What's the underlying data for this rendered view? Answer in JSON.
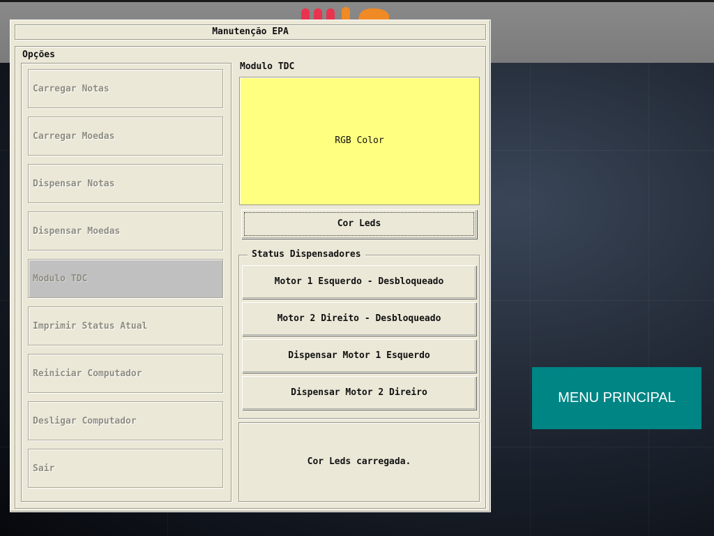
{
  "dialog": {
    "title": "Manutenção EPA",
    "options_label": "Opções",
    "options": [
      {
        "label": "Carregar Notas",
        "active": false
      },
      {
        "label": "Carregar Moedas",
        "active": false
      },
      {
        "label": "Dispensar Notas",
        "active": false
      },
      {
        "label": "Dispensar Moedas",
        "active": false
      },
      {
        "label": "Modulo TDC",
        "active": true
      },
      {
        "label": "Imprimir Status Atual",
        "active": false
      },
      {
        "label": "Reiniciar Computador",
        "active": false
      },
      {
        "label": "Desligar Computador",
        "active": false
      },
      {
        "label": "Sair",
        "active": false
      }
    ],
    "module_title": "Modulo TDC",
    "color_swatch": {
      "label": "RGB Color",
      "color": "#ffff80"
    },
    "cor_leds_button": "Cor Leds",
    "status_title": "Status Dispensadores",
    "status_buttons": [
      "Motor 1 Esquerdo - Desbloqueado",
      "Motor 2 Direito - Desbloqueado",
      "Dispensar Motor 1 Esquerdo",
      "Dispensar Motor 2 Direiro"
    ],
    "message": "Cor Leds carregada."
  },
  "menu_principal": {
    "label": "MENU PRINCIPAL",
    "color": "#008585"
  },
  "colors": {
    "dialog_bg": "#ebe8d8",
    "active_option": "#c0c0c0",
    "accent": "#008585"
  }
}
